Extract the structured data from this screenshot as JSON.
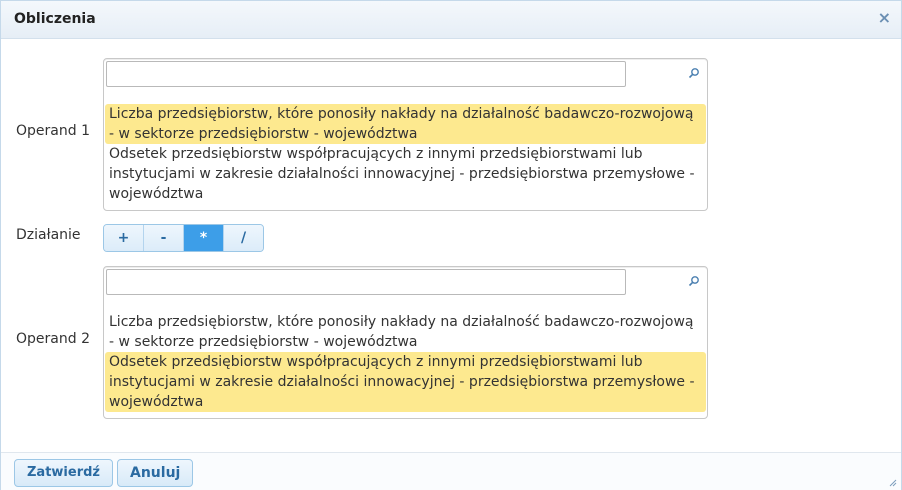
{
  "dialog": {
    "title": "Obliczenia",
    "close_symbol": "×"
  },
  "operand1": {
    "label": "Operand 1",
    "search_value": "",
    "options": [
      {
        "text": "Liczba przedsiębiorstw, które ponosiły nakłady na działalność badawczo-rozwojową - w sektorze przedsiębiorstw - województwa",
        "selected": true
      },
      {
        "text": "Odsetek przedsiębiorstw współpracujących z innymi przedsiębiorstwami lub instytucjami w zakresie działalności innowacyjnej - przedsiębiorstwa przemysłowe - województwa",
        "selected": false
      }
    ]
  },
  "operation": {
    "label": "Działanie",
    "buttons": [
      "+",
      "-",
      "*",
      "/"
    ],
    "active": "*"
  },
  "operand2": {
    "label": "Operand 2",
    "search_value": "",
    "options": [
      {
        "text": "Liczba przedsiębiorstw, które ponosiły nakłady na działalność badawczo-rozwojową - w sektorze przedsiębiorstw - województwa",
        "selected": false
      },
      {
        "text": "Odsetek przedsiębiorstw współpracujących z innymi przedsiębiorstwami lub instytucjami w zakresie działalności innowacyjnej - przedsiębiorstwa przemysłowe - województwa",
        "selected": true
      }
    ]
  },
  "footer": {
    "confirm_label": "Zatwierdź",
    "cancel_label": "Anuluj"
  },
  "colors": {
    "selected_bg": "#fde98f",
    "accent": "#3d9ee8",
    "button_text": "#2a6aa1"
  }
}
